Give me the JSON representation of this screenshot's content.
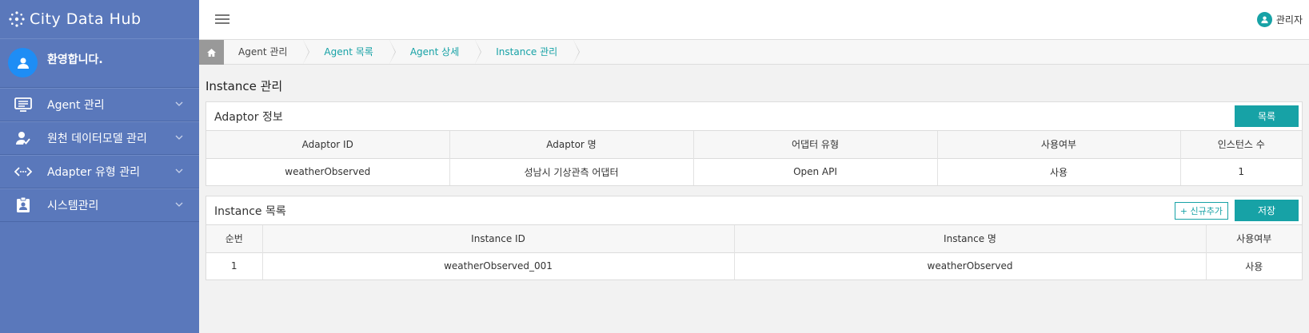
{
  "app": {
    "title": "City Data Hub"
  },
  "sidebar": {
    "welcome": "환영합니다.",
    "items": [
      {
        "label": "Agent 관리",
        "icon": "monitor-list-icon"
      },
      {
        "label": "원천 데이터모델 관리",
        "icon": "user-check-icon"
      },
      {
        "label": "Adapter 유형 관리",
        "icon": "code-arrows-icon"
      },
      {
        "label": "시스템관리",
        "icon": "id-badge-icon"
      }
    ]
  },
  "topbar": {
    "user_label": "관리자"
  },
  "breadcrumb": [
    "Agent 관리",
    "Agent 목록",
    "Agent 상세",
    "Instance 관리"
  ],
  "page": {
    "title": "Instance 관리"
  },
  "adaptor_panel": {
    "title": "Adaptor 정보",
    "list_button": "목록",
    "columns": [
      "Adaptor ID",
      "Adaptor 명",
      "어댑터 유형",
      "사용여부",
      "인스턴스 수"
    ],
    "rows": [
      [
        "weatherObserved",
        "성남시 기상관측 어댑터",
        "Open API",
        "사용",
        "1"
      ]
    ]
  },
  "instance_panel": {
    "title": "Instance 목록",
    "add_button": "+ 신규추가",
    "save_button": "저장",
    "columns": [
      "순번",
      "Instance ID",
      "Instance 명",
      "사용여부"
    ],
    "rows": [
      [
        "1",
        "weatherObserved_001",
        "weatherObserved",
        "사용"
      ]
    ]
  },
  "colors": {
    "sidebar": "#5a78bb",
    "accent": "#17a2a6",
    "avatar": "#1e8df5"
  }
}
